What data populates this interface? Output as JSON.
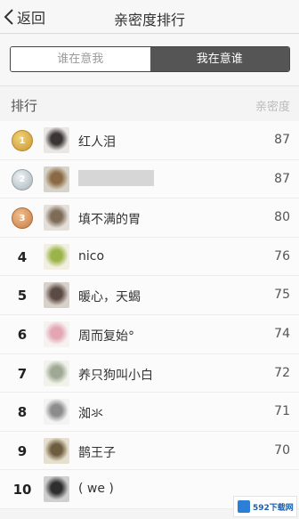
{
  "nav": {
    "back_label": "返回",
    "title": "亲密度排行"
  },
  "segment": {
    "left": "谁在意我",
    "right": "我在意谁",
    "selected": "right"
  },
  "header": {
    "rank_label": "排行",
    "score_label": "亲密度"
  },
  "rows": [
    {
      "rank": "1",
      "medal": "gold",
      "name": "红人泪",
      "score": "87",
      "avatar_colors": [
        "#e9e6e4",
        "#3a3533"
      ]
    },
    {
      "rank": "2",
      "medal": "silver",
      "name": "",
      "score": "87",
      "avatar_colors": [
        "#d8d3c8",
        "#8a6a45"
      ]
    },
    {
      "rank": "3",
      "medal": "bronze",
      "name": "填不满的胃",
      "score": "80",
      "avatar_colors": [
        "#e4e0d8",
        "#7e6b58"
      ]
    },
    {
      "rank": "4",
      "medal": "",
      "name": "nico",
      "score": "76",
      "avatar_colors": [
        "#f2efe0",
        "#9bb44a"
      ]
    },
    {
      "rank": "5",
      "medal": "",
      "name": "暖心，天蝎",
      "score": "75",
      "avatar_colors": [
        "#d9d0ca",
        "#5c4a44"
      ]
    },
    {
      "rank": "6",
      "medal": "",
      "name": "周而复始°",
      "score": "74",
      "avatar_colors": [
        "#f5f2f1",
        "#e5a6b4"
      ]
    },
    {
      "rank": "7",
      "medal": "",
      "name": "养只狗叫小白",
      "score": "72",
      "avatar_colors": [
        "#f1f2ea",
        "#9ea894"
      ]
    },
    {
      "rank": "8",
      "medal": "",
      "name": "洳氺",
      "score": "71",
      "avatar_colors": [
        "#f3f3f3",
        "#8c8c8c"
      ]
    },
    {
      "rank": "9",
      "medal": "",
      "name": "鹊王子",
      "score": "70",
      "avatar_colors": [
        "#e6dfcf",
        "#6e5c3e"
      ]
    },
    {
      "rank": "10",
      "medal": "",
      "name": "( we )",
      "score": "",
      "avatar_colors": [
        "#cfcfcf",
        "#2e2e2e"
      ]
    }
  ],
  "watermark": {
    "text": "592下载网"
  }
}
